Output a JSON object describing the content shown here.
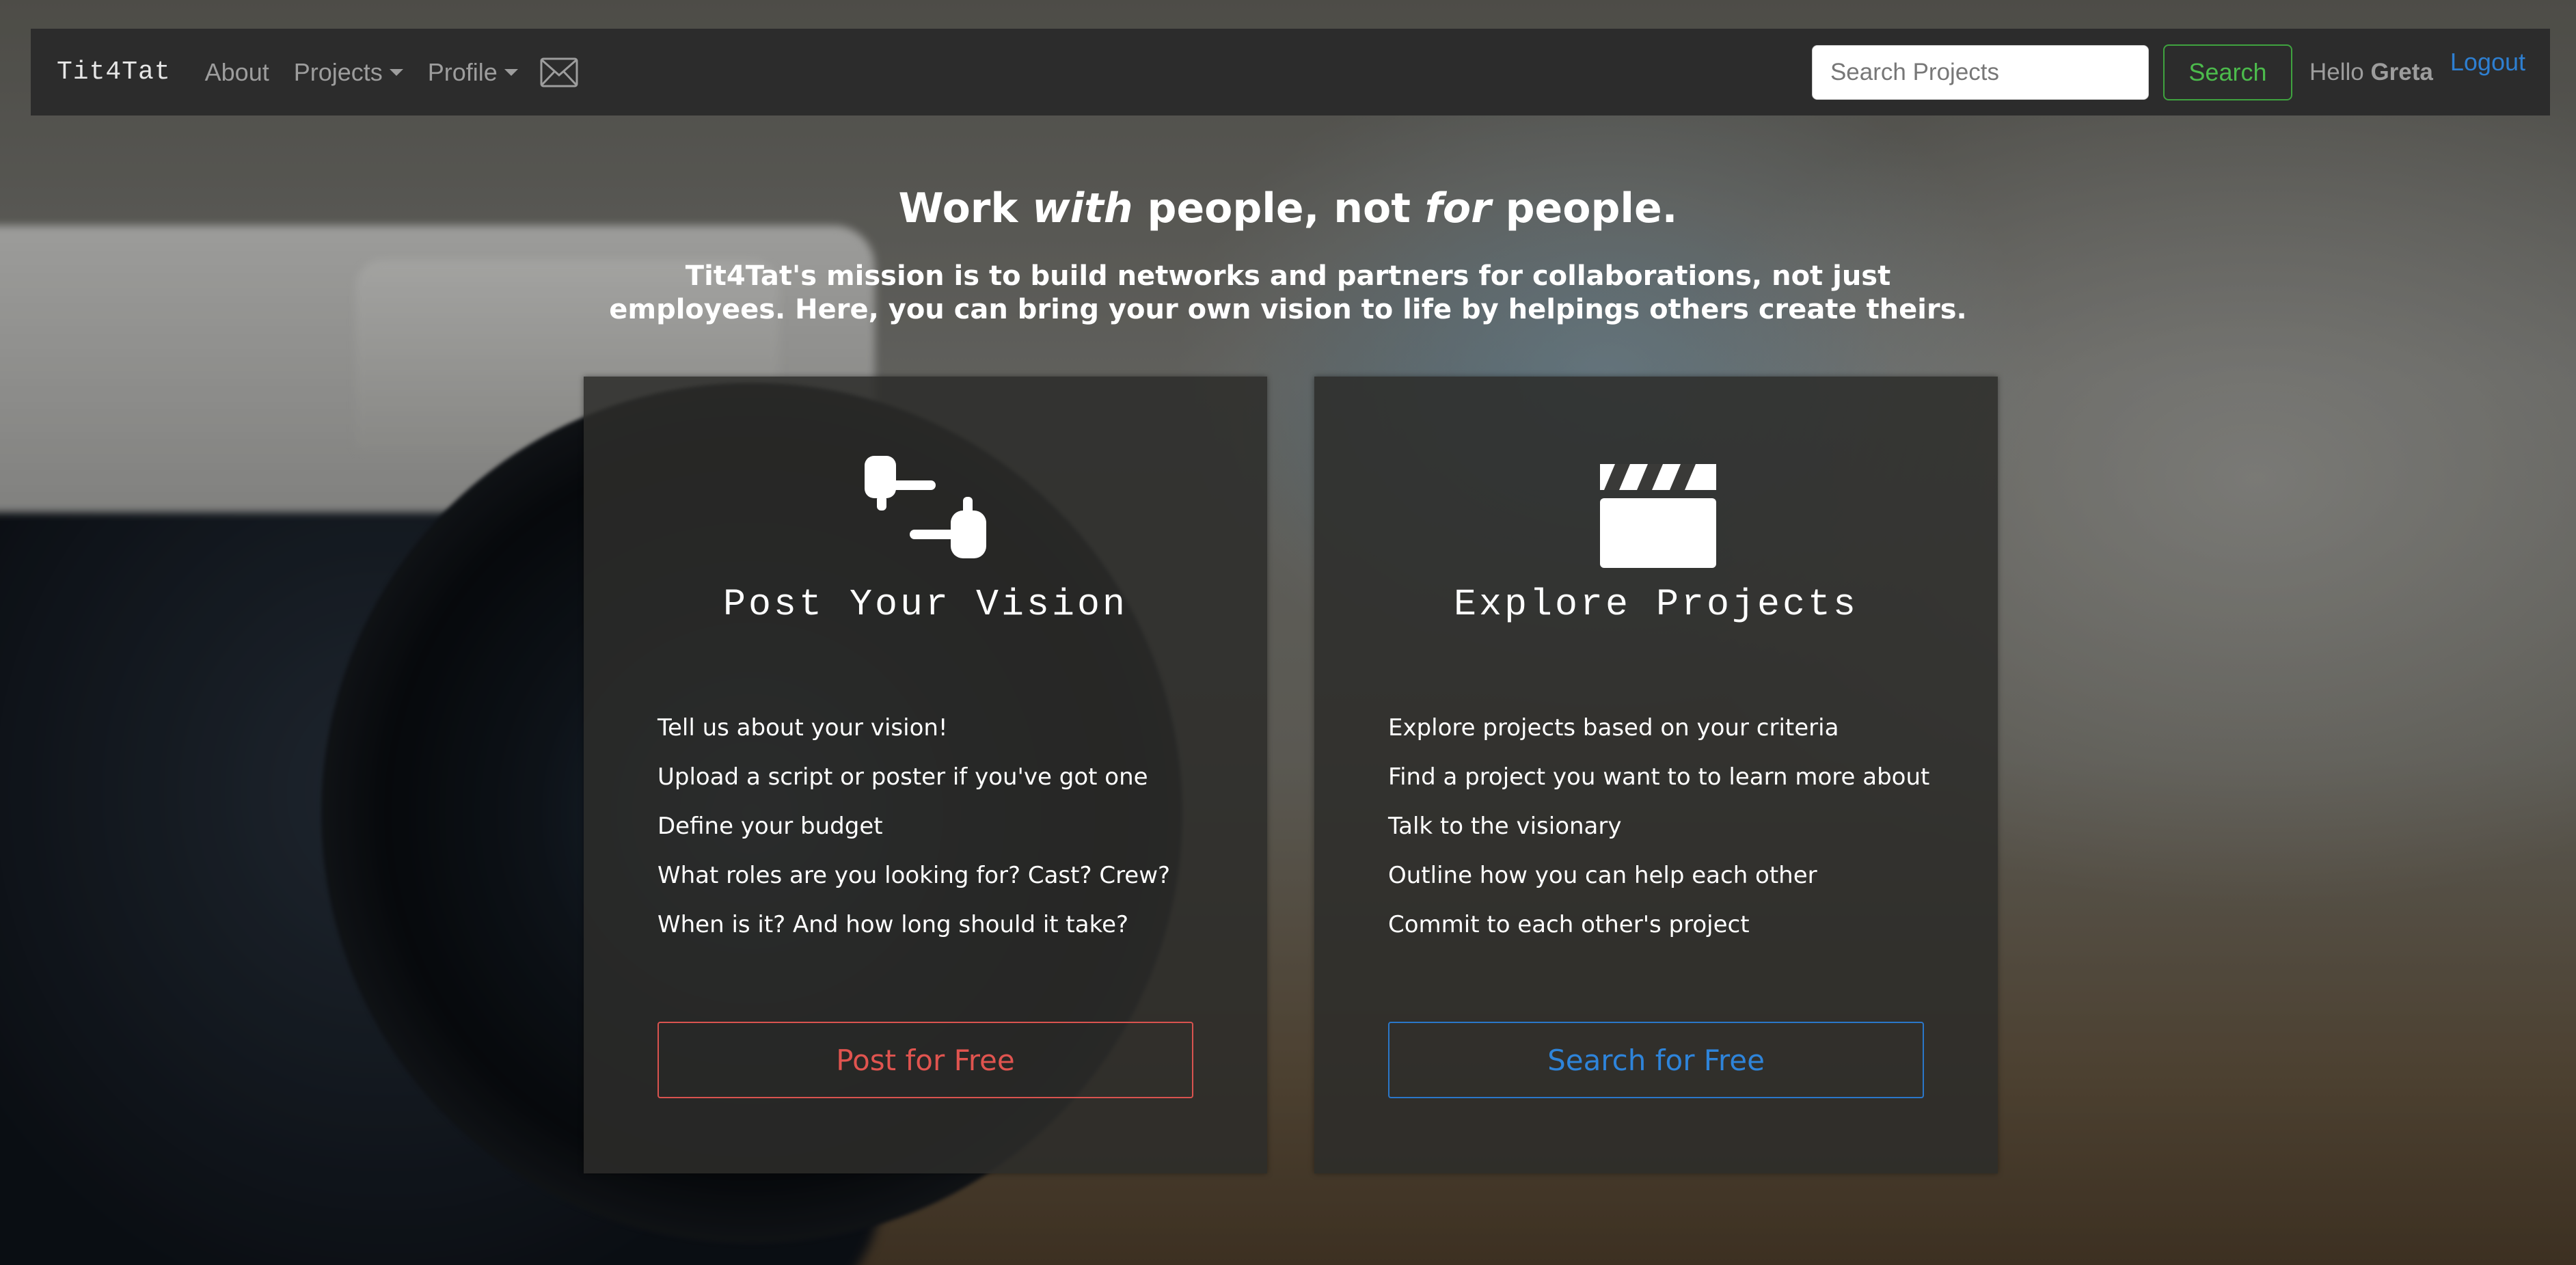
{
  "navbar": {
    "brand": "Tit4Tat",
    "about": "About",
    "projects": "Projects",
    "profile": "Profile",
    "search_placeholder": "Search Projects",
    "search_button": "Search",
    "hello_prefix": "Hello",
    "user_name": "Greta",
    "logout": "Logout"
  },
  "hero": {
    "title_part1": "Work ",
    "title_em1": "with",
    "title_part2": " people, not ",
    "title_em2": "for",
    "title_part3": " people.",
    "subtitle": "Tit4Tat's mission is to build networks and partners for collaborations, not just employees. Here, you can bring your own vision to life by helpings others create theirs."
  },
  "cards": {
    "post": {
      "icon": "pointing-hands-icon",
      "title": "Post Your Vision",
      "items": [
        "Tell us about your vision!",
        "Upload a script or poster if you've got one",
        "Define your budget",
        "What roles are you looking for? Cast? Crew?",
        "When is it? And how long should it take?"
      ],
      "button": "Post for Free"
    },
    "explore": {
      "icon": "clapperboard-icon",
      "title": "Explore Projects",
      "items": [
        "Explore projects based on your criteria",
        "Find a project you want to to learn more about",
        "Talk to the visionary",
        "Outline how you can help each other",
        "Commit to each other's project"
      ],
      "button": "Search for Free"
    }
  },
  "colors": {
    "post_accent": "#d9534f",
    "explore_accent": "#2a77c9",
    "search_accent": "#3fa33f",
    "logout_link": "#2e7fd1"
  }
}
